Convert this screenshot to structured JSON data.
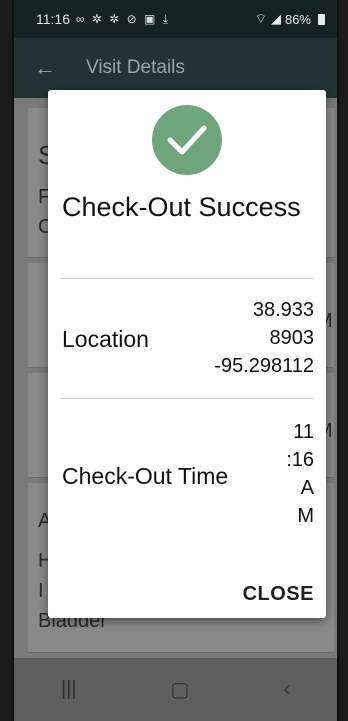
{
  "status_bar": {
    "time": "11:16",
    "notification_icons": "∞ ✲ ✲ ⊘ ▣ ⤓",
    "battery_percent": "86%"
  },
  "app_bar": {
    "title": "Visit Details"
  },
  "background": {
    "fragments": [
      "S",
      "F",
      "C",
      "M",
      "M",
      "A",
      "H",
      "I",
      "Bladder"
    ]
  },
  "dialog": {
    "title": "Check-Out Success",
    "location_label": "Location",
    "location_lines": [
      "38.933",
      "8903",
      "-95.298112"
    ],
    "time_label": "Check-Out Time",
    "time_lines": [
      "11",
      ":16",
      "A",
      "M"
    ],
    "close_label": "CLOSE",
    "check_color": "#6fa57a"
  }
}
